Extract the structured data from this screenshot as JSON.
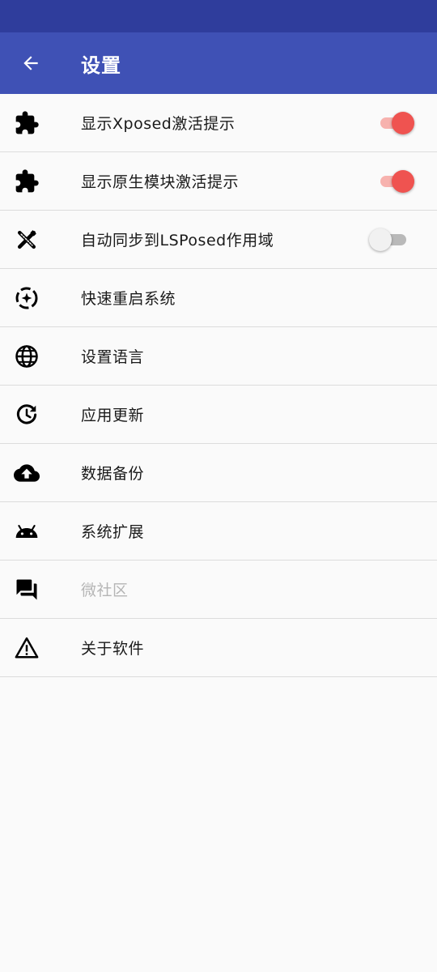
{
  "header": {
    "title": "设置",
    "back_icon": "arrow-back-icon"
  },
  "colors": {
    "status_bar": "#2f3d9c",
    "app_bar": "#3f51b5",
    "switch_on": "#ef5350",
    "disabled_text": "#b5b5b5"
  },
  "settings": {
    "items": [
      {
        "label": "显示Xposed激活提示",
        "icon": "puzzle-icon",
        "switch": "on"
      },
      {
        "label": "显示原生模块激活提示",
        "icon": "puzzle-icon",
        "switch": "on"
      },
      {
        "label": "自动同步到LSPosed作用域",
        "icon": "tools-icon",
        "switch": "off"
      },
      {
        "label": "快速重启系统",
        "icon": "restart-icon"
      },
      {
        "label": "设置语言",
        "icon": "globe-icon"
      },
      {
        "label": "应用更新",
        "icon": "update-icon"
      },
      {
        "label": "数据备份",
        "icon": "cloud-upload-icon"
      },
      {
        "label": "系统扩展",
        "icon": "android-icon"
      },
      {
        "label": "微社区",
        "icon": "forum-icon",
        "disabled": true
      },
      {
        "label": "关于软件",
        "icon": "warning-icon"
      }
    ]
  }
}
